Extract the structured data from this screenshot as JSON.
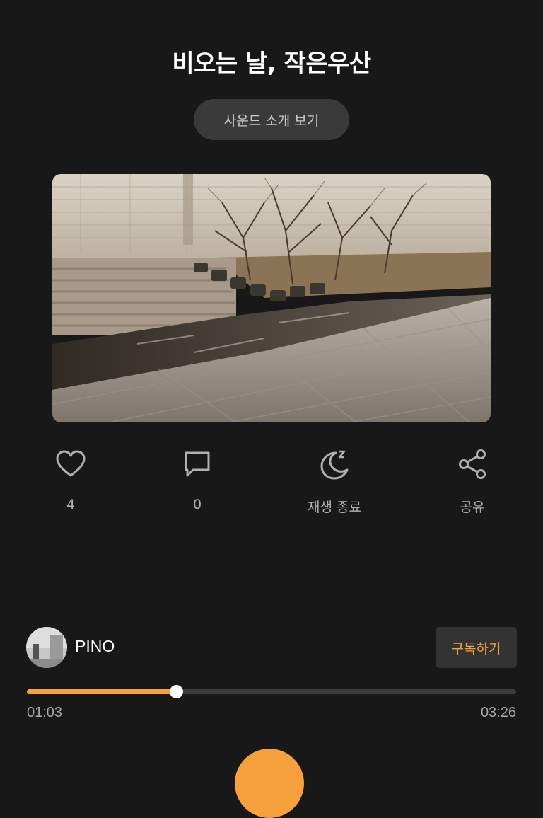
{
  "track": {
    "title": "비오는 날, 작은우산",
    "intro_button_label": "사운드 소개 보기"
  },
  "actions": {
    "like": {
      "icon": "heart-icon",
      "label": "4"
    },
    "comment": {
      "icon": "comment-icon",
      "label": "0"
    },
    "sleep_timer": {
      "icon": "moon-sleep-icon",
      "label": "재생 종료"
    },
    "share": {
      "icon": "share-icon",
      "label": "공유"
    }
  },
  "artist": {
    "name": "PINO",
    "subscribe_label": "구독하기"
  },
  "player": {
    "current_time": "01:03",
    "total_time": "03:26",
    "progress": 0.3055
  },
  "colors": {
    "background": "#181818",
    "accent": "#f7a13c",
    "muted_text": "#b0b0b0"
  }
}
